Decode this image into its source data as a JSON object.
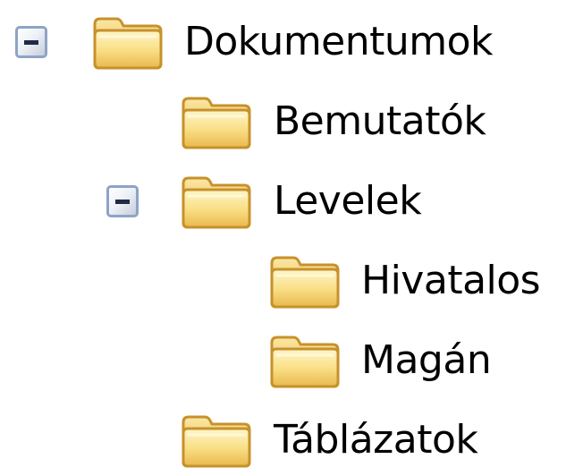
{
  "tree": {
    "root": {
      "label": "Dokumentumok",
      "expanded": true,
      "icon": "folder-icon",
      "children": [
        {
          "label": "Bemutatók",
          "icon": "folder-icon"
        },
        {
          "label": "Levelek",
          "expanded": true,
          "icon": "folder-icon",
          "children": [
            {
              "label": "Hivatalos",
              "icon": "folder-icon"
            },
            {
              "label": "Magán",
              "icon": "folder-icon"
            }
          ]
        },
        {
          "label": "Táblázatok",
          "icon": "folder-icon"
        }
      ]
    },
    "expander_icon": "minus-box-icon",
    "colors": {
      "folder_fill": "#f6d677",
      "folder_light": "#fff3b8",
      "folder_edge": "#c7912b",
      "expander_border": "#8ea3c6"
    }
  }
}
